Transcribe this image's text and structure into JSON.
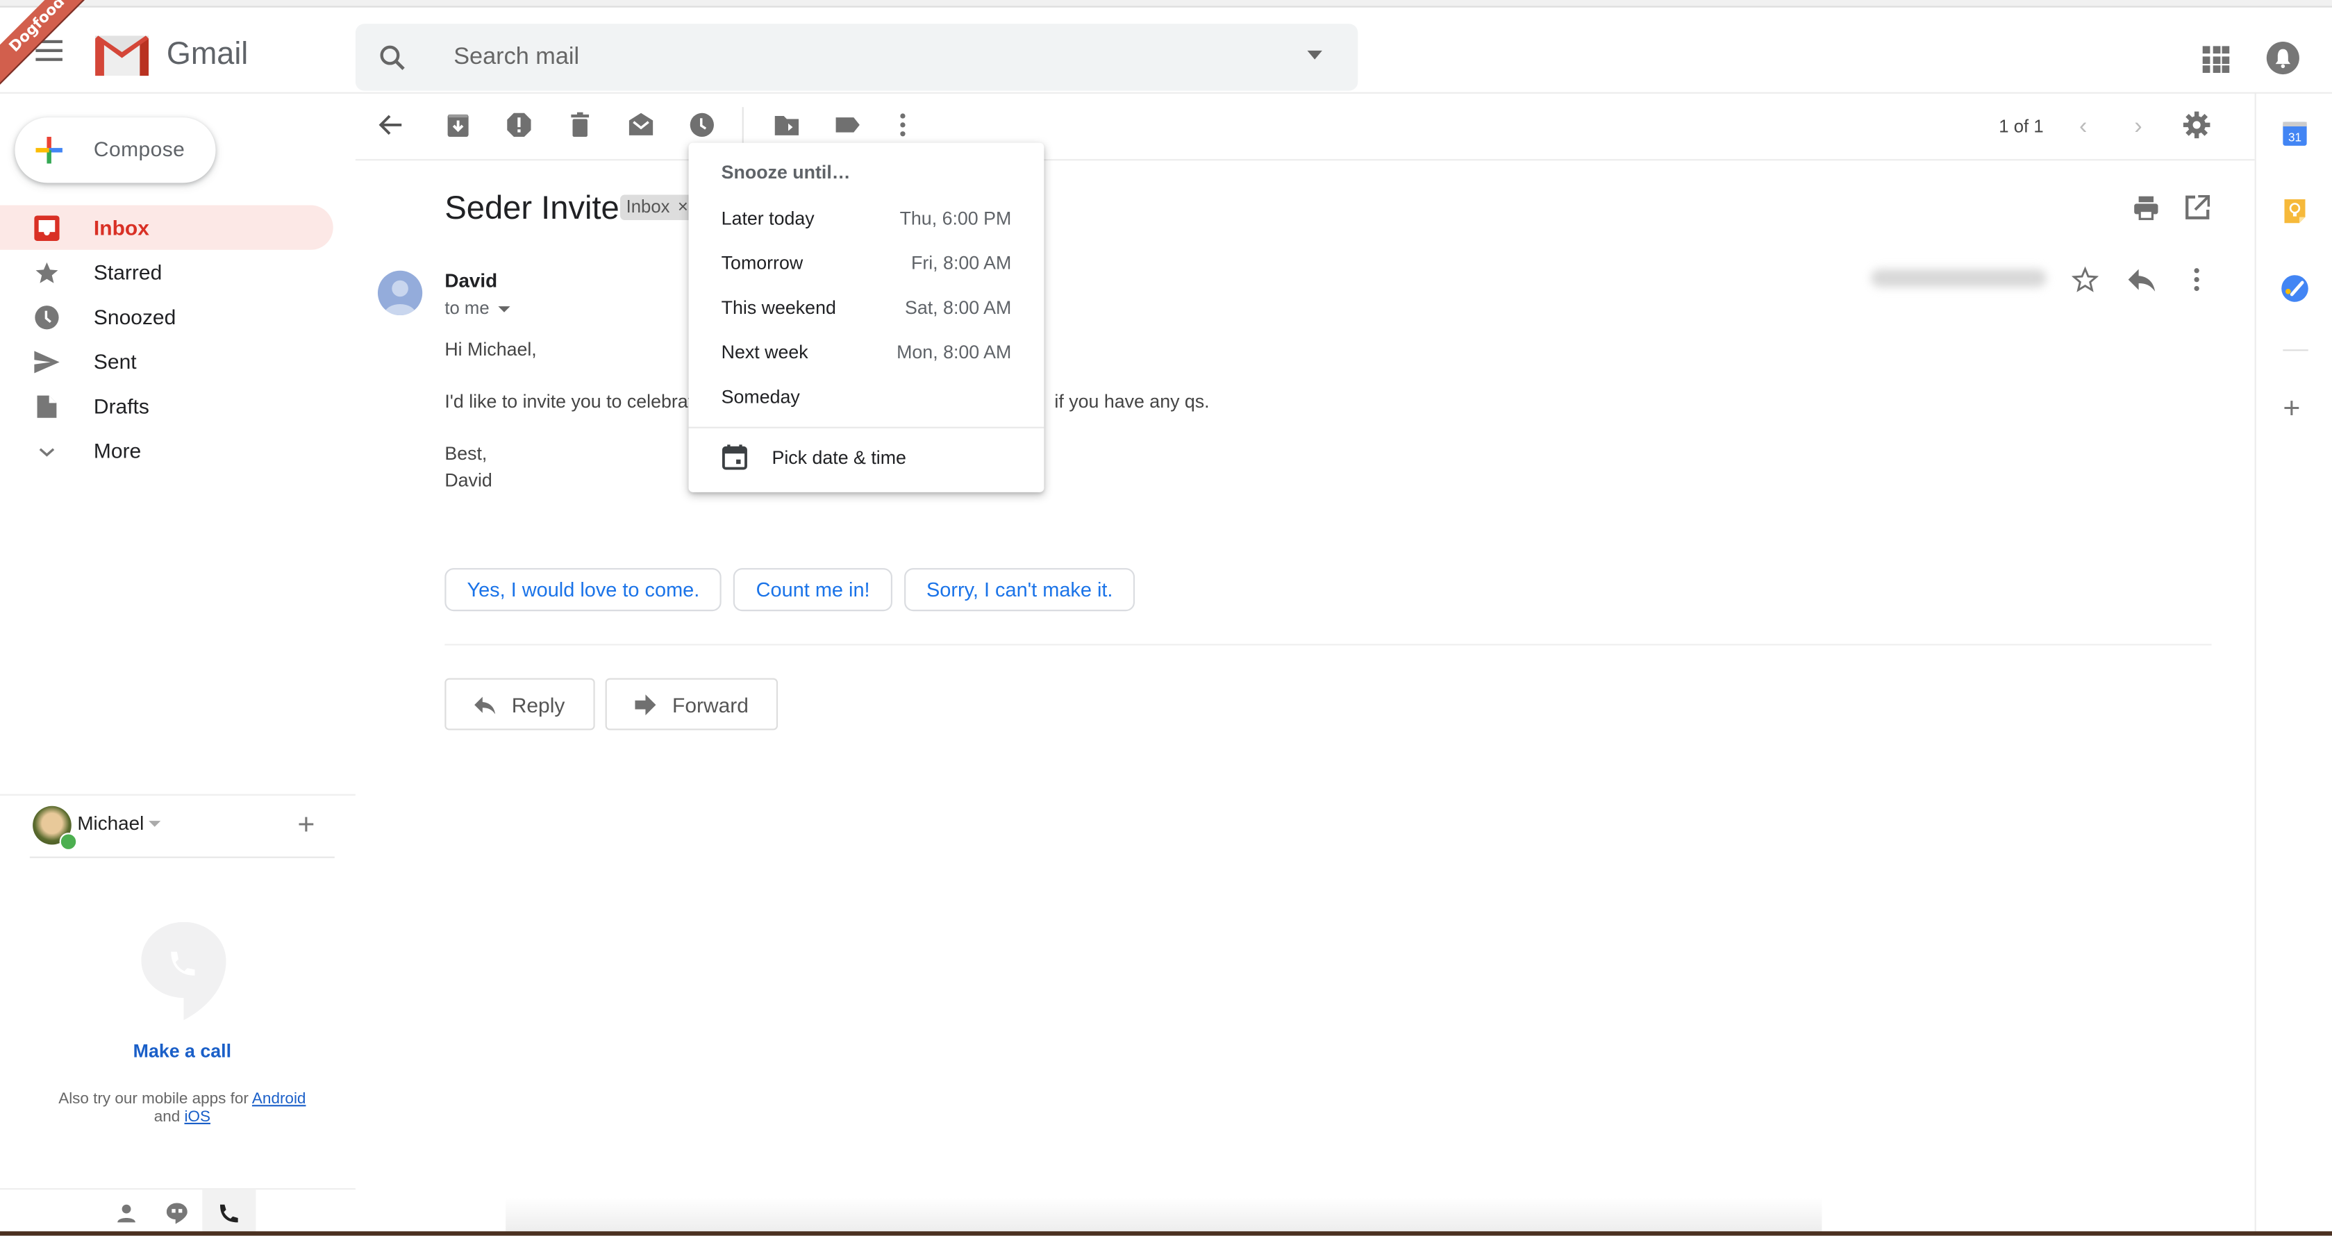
{
  "header": {
    "badge": "Dogfood",
    "brand": "Gmail",
    "search_placeholder": "Search mail"
  },
  "compose": {
    "label": "Compose"
  },
  "nav": {
    "items": [
      {
        "label": "Inbox",
        "icon": "inbox-icon",
        "active": true
      },
      {
        "label": "Starred",
        "icon": "star-icon"
      },
      {
        "label": "Snoozed",
        "icon": "clock-icon"
      },
      {
        "label": "Sent",
        "icon": "send-icon"
      },
      {
        "label": "Drafts",
        "icon": "draft-icon"
      },
      {
        "label": "More",
        "icon": "chevron-down-icon"
      }
    ]
  },
  "hangouts": {
    "user": "Michael",
    "make_call": "Make a call",
    "also_try": "Also try our mobile apps for",
    "android": "Android",
    "and": "and",
    "ios": "iOS"
  },
  "toolbar": {
    "pager": "1 of 1"
  },
  "message": {
    "subject": "Seder Invite",
    "label_chip": "Inbox",
    "sender": "David",
    "recipient": "to me",
    "body": {
      "greeting": "Hi Michael,",
      "line_visible_start": "I'd like to invite you to celebrate",
      "line_visible_end": "if you have any qs.",
      "signoff": "Best,",
      "signature": "David"
    },
    "smart_replies": [
      "Yes, I would love to come.",
      "Count me in!",
      "Sorry, I can't make it."
    ],
    "reply_label": "Reply",
    "forward_label": "Forward"
  },
  "snooze_menu": {
    "title": "Snooze until…",
    "options": [
      {
        "label": "Later today",
        "time": "Thu, 6:00 PM"
      },
      {
        "label": "Tomorrow",
        "time": "Fri, 8:00 AM"
      },
      {
        "label": "This weekend",
        "time": "Sat, 8:00 AM"
      },
      {
        "label": "Next week",
        "time": "Mon, 8:00 AM"
      },
      {
        "label": "Someday",
        "time": ""
      }
    ],
    "pick": "Pick date & time"
  },
  "rail": {
    "calendar_day": "31"
  },
  "colors": {
    "accent_red": "#d93025",
    "link_blue": "#1a73e8",
    "active_bg": "#fce8e6"
  }
}
